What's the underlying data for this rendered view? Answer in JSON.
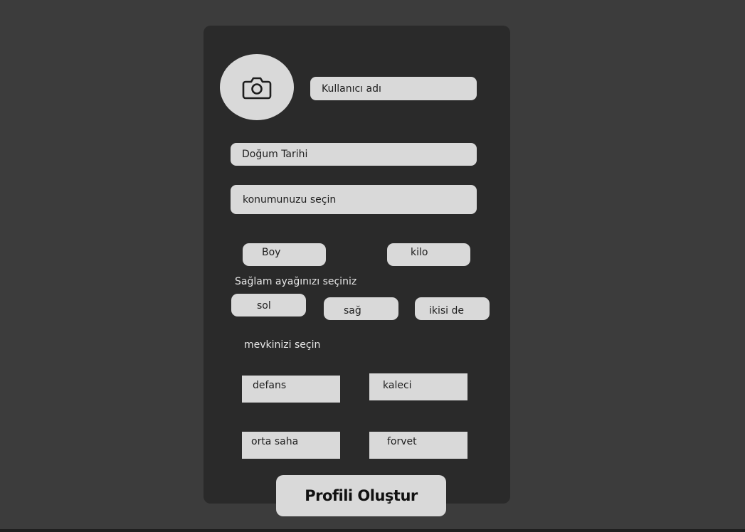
{
  "form": {
    "avatar_icon": "camera-icon",
    "username_placeholder": "Kullanıcı adı",
    "birthdate_placeholder": "Doğum Tarihi",
    "location_placeholder": "konumunuzu seçin",
    "height_label": "Boy",
    "weight_label": "kilo",
    "foot_label": "Sağlam ayağınızı seçiniz",
    "foot_options": [
      "sol",
      "sağ",
      "ikisi de"
    ],
    "position_label": "mevkinizi seçin",
    "position_options": [
      "defans",
      "kaleci",
      "orta saha",
      "forvet"
    ],
    "submit_label": "Profili Oluştur"
  },
  "colors": {
    "background": "#3c3c3c",
    "panel": "#2a2a2a",
    "control": "#d9d9d9"
  }
}
